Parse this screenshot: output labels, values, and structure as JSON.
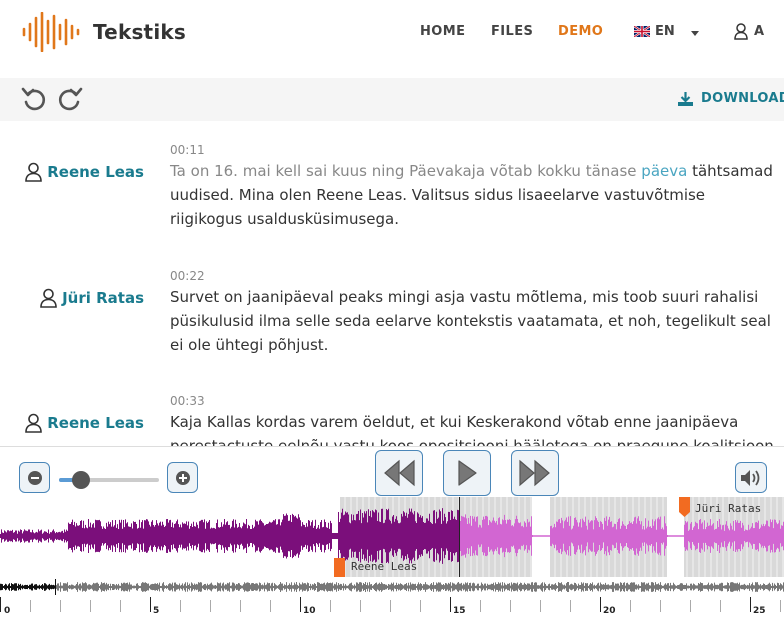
{
  "app": {
    "name": "Tekstiks"
  },
  "nav": {
    "home": "HOME",
    "files": "FILES",
    "demo": "DEMO",
    "lang": "EN",
    "user": "A"
  },
  "toolbar": {
    "download": "DOWNLOAD"
  },
  "transcript": [
    {
      "time": "00:11",
      "speaker": "Reene Leas",
      "played": "Ta on 16. mai kell sai kuus ning Päevakaja võtab kokku tänase ",
      "current": "päeva",
      "rest": " tähtsamad uudised. Mina olen Reene Leas. Valitsus sidus lisaeelarve vastuvõtmise riigikogus usaldusküsimusega."
    },
    {
      "time": "00:22",
      "speaker": "Jüri Ratas",
      "played": "",
      "current": "",
      "rest": "Survet on jaanipäeval peaks mingi asja vastu mõtlema, mis toob suuri rahalisi püsikulusid ilma selle seda eelarve kontekstis vaatamata, et noh, tegelikult seal ei ole ühtegi põhjust."
    },
    {
      "time": "00:33",
      "speaker": "Reene Leas",
      "played": "",
      "current": "",
      "rest": "Kaja Kallas kordas varem öeldut, et kui Keskerakond võtab enne jaanipäeva perestactuste eelnõu vastu koos opositsiooni hääletega on praegune koalitsioon"
    }
  ],
  "player": {
    "zoom_level": 0.22,
    "segments": [
      {
        "label": "Reene Leas"
      },
      {
        "label": "Jüri Ratas"
      }
    ],
    "timeline_ticks": [
      "0",
      "5",
      "10",
      "15",
      "20",
      "25"
    ]
  },
  "colors": {
    "accent": "#e0771a",
    "teal": "#1a7b8e",
    "wave_played": "#7b0f7b",
    "wave_unplayed": "#d266d2"
  }
}
